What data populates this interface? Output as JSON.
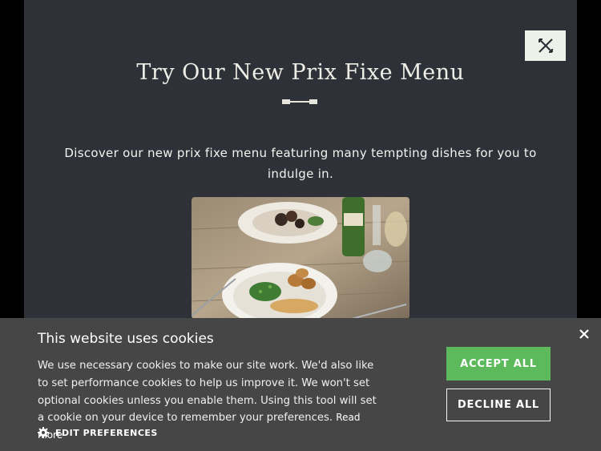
{
  "modal": {
    "title": "Try Our New Prix Fixe Menu",
    "description": "Discover our new prix fixe menu featuring many tempting dishes for you to indulge in.",
    "close_icon": "close-x-icon",
    "image_alt": "plated-dishes-photo"
  },
  "cookie_banner": {
    "title": "This website uses cookies",
    "body": "We use necessary cookies to make our site work. We'd also like to set performance cookies to help us improve it. We won't set optional cookies unless you enable them. Using this tool will set a cookie on your device to remember your preferences.",
    "read_more": "Read more",
    "edit_preferences": "EDIT PREFERENCES",
    "accept_all": "ACCEPT ALL",
    "decline_all": "DECLINE ALL",
    "accent_color": "#5cba5c"
  }
}
